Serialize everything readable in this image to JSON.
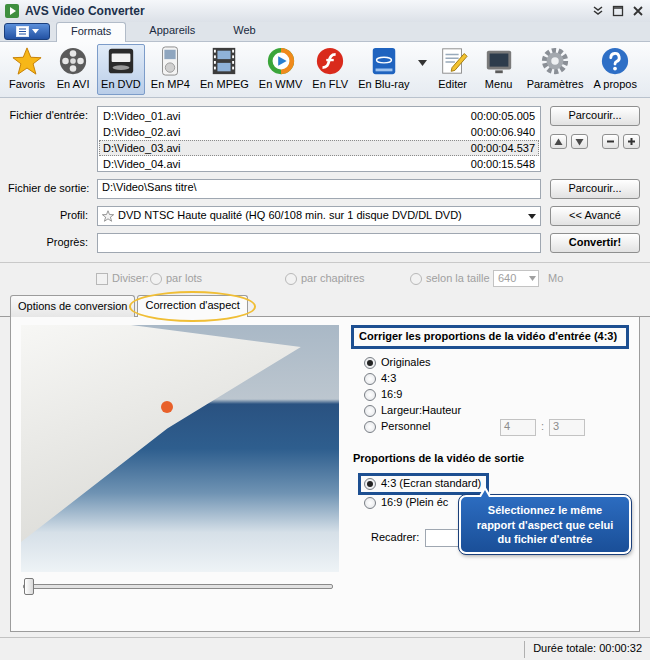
{
  "window": {
    "title": "AVS Video Converter"
  },
  "ribbon_tabs": [
    {
      "label": "Formats",
      "selected": true
    },
    {
      "label": "Appareils",
      "selected": false
    },
    {
      "label": "Web",
      "selected": false
    }
  ],
  "toolbar": [
    {
      "label": "Favoris",
      "selected": false
    },
    {
      "label": "En AVI",
      "selected": false
    },
    {
      "label": "En DVD",
      "selected": true
    },
    {
      "label": "En MP4",
      "selected": false
    },
    {
      "label": "En MPEG",
      "selected": false
    },
    {
      "label": "En WMV",
      "selected": false
    },
    {
      "label": "En FLV",
      "selected": false
    },
    {
      "label": "En Blu-ray",
      "selected": false
    },
    {
      "label": "Editer",
      "selected": false
    },
    {
      "label": "Menu",
      "selected": false
    },
    {
      "label": "Paramètres",
      "selected": false
    },
    {
      "label": "A propos",
      "selected": false
    }
  ],
  "input_files": {
    "label": "Fichier d'entrée:",
    "button": "Parcourir...",
    "rows": [
      {
        "name": "D:\\Video_01.avi",
        "duration": "00:00:05.005",
        "selected": false
      },
      {
        "name": "D:\\Video_02.avi",
        "duration": "00:00:06.940",
        "selected": false
      },
      {
        "name": "D:\\Video_03.avi",
        "duration": "00:00:04.537",
        "selected": true
      },
      {
        "name": "D:\\Video_04.avi",
        "duration": "00:00:15.548",
        "selected": false
      }
    ]
  },
  "output": {
    "label": "Fichier de sortie:",
    "value": "D:\\Video\\Sans titre\\",
    "button": "Parcourir..."
  },
  "profile": {
    "label": "Profil:",
    "value": "DVD NTSC Haute qualité (HQ 60/108 min. sur 1 disque DVD/DL DVD)",
    "button": "<< Avancé"
  },
  "progress": {
    "label": "Progrès:",
    "level": 0,
    "button": "Convertir!"
  },
  "split": {
    "disabled": true,
    "checkbox": {
      "label": "Diviser:",
      "checked": false
    },
    "options": [
      {
        "label": "par lots",
        "selected": false
      },
      {
        "label": "par chapitres",
        "selected": false
      },
      {
        "label": "selon la taille",
        "selected": false
      }
    ],
    "size": "640",
    "unit": "Mo"
  },
  "panel_tabs": [
    {
      "label": "Options de conversion",
      "selected": false
    },
    {
      "label": "Correction d'aspect",
      "selected": true
    }
  ],
  "preview": {
    "slider": {
      "level": 0
    }
  },
  "input_aspect": {
    "title": "Corriger les proportions de la vidéo d'entrée (4:3)",
    "options": [
      {
        "label": "Originales",
        "selected": true,
        "kind": "plain"
      },
      {
        "label": "4:3",
        "selected": false,
        "kind": "plain"
      },
      {
        "label": "16:9",
        "selected": false,
        "kind": "plain"
      },
      {
        "label": "Largeur:Hauteur",
        "selected": false,
        "kind": "plain"
      },
      {
        "label": "Personnel",
        "selected": false,
        "kind": "custom"
      }
    ],
    "custom": {
      "width": "4",
      "separator": ":",
      "height": "3",
      "disabled": true
    }
  },
  "output_aspect": {
    "title": "Proportions de la vidéo de sortie",
    "options": [
      {
        "label": "4:3 (Ecran standard)",
        "selected": true
      },
      {
        "label": "16:9 (Plein éc",
        "selected": false
      }
    ],
    "crop_label": "Recadrer:"
  },
  "callout": {
    "text": "Sélectionnez le même rapport d'aspect que celui du fichier d'entrée"
  },
  "status_bar": {
    "total": "Durée totale: 00:00:32"
  }
}
